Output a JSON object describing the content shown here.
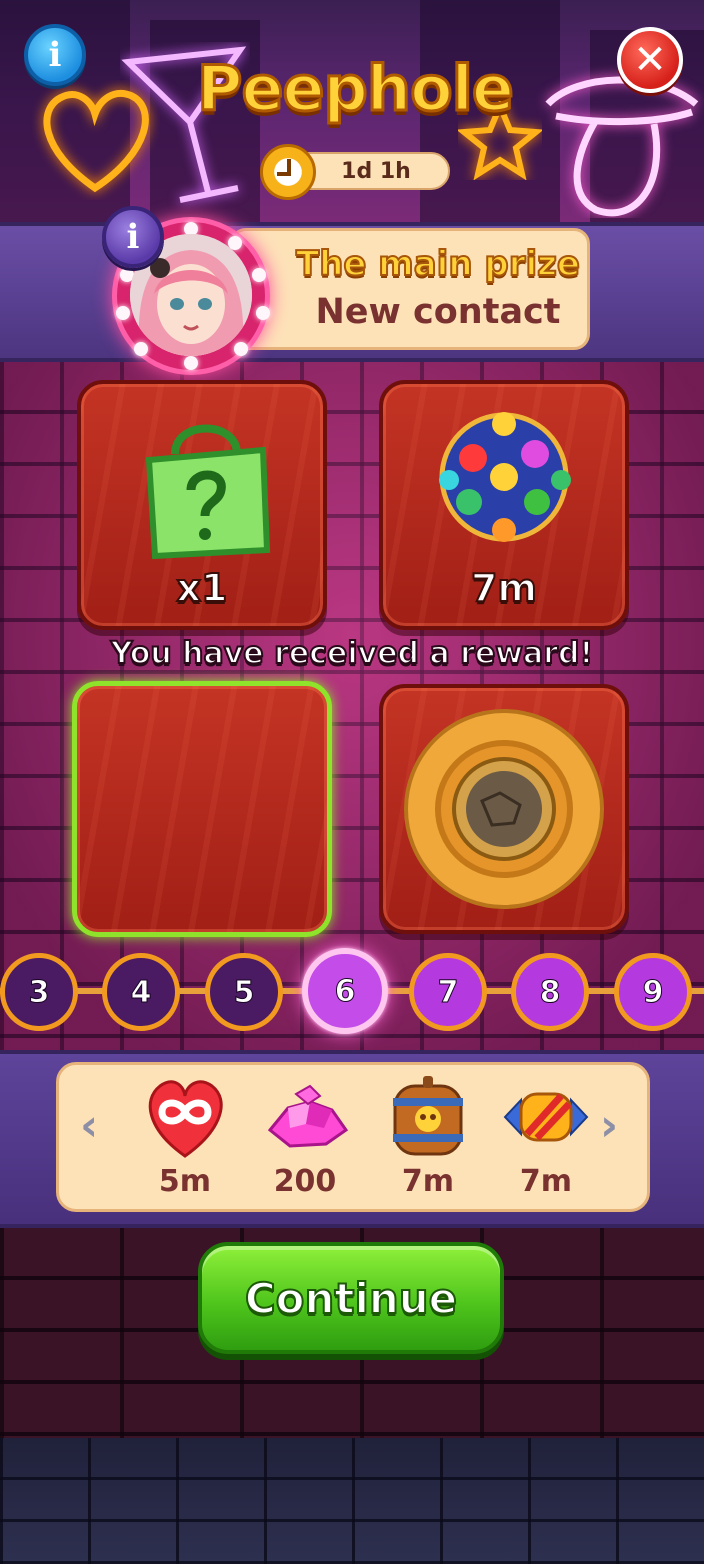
{
  "header": {
    "title": "Peephole",
    "timer": "1d 1h"
  },
  "buttons": {
    "info_glyph": "i",
    "close_glyph": "✕"
  },
  "prize": {
    "title": "The main prize",
    "subtitle": "New contact"
  },
  "tiles": [
    {
      "label": "x1",
      "icon": "mystery-bag-icon",
      "state": "revealed"
    },
    {
      "label": "7m",
      "icon": "disco-bomb-icon",
      "state": "revealed"
    },
    {
      "label": "",
      "icon": "",
      "state": "selected-empty"
    },
    {
      "label": "",
      "icon": "peephole-lens-icon",
      "state": "hidden"
    }
  ],
  "message": "You have received a reward!",
  "levels": [
    {
      "n": "3",
      "state": "done"
    },
    {
      "n": "4",
      "state": "done"
    },
    {
      "n": "5",
      "state": "done"
    },
    {
      "n": "6",
      "state": "current"
    },
    {
      "n": "7",
      "state": "open"
    },
    {
      "n": "8",
      "state": "open"
    },
    {
      "n": "9",
      "state": "open"
    }
  ],
  "rewards_strip": [
    {
      "icon": "infinite-heart-icon",
      "value": "5m"
    },
    {
      "icon": "gems-icon",
      "value": "200"
    },
    {
      "icon": "skull-barrel-icon",
      "value": "7m"
    },
    {
      "icon": "rocket-booster-icon",
      "value": "7m"
    }
  ],
  "nav": {
    "prev": "‹",
    "next": "›"
  },
  "continue_label": "Continue",
  "colors": {
    "accent_green": "#4fc51c",
    "title_gold": "#ffd23a",
    "panel_purple": "#5e449a",
    "tile_red": "#c43424",
    "level_purple": "#b43adf"
  }
}
